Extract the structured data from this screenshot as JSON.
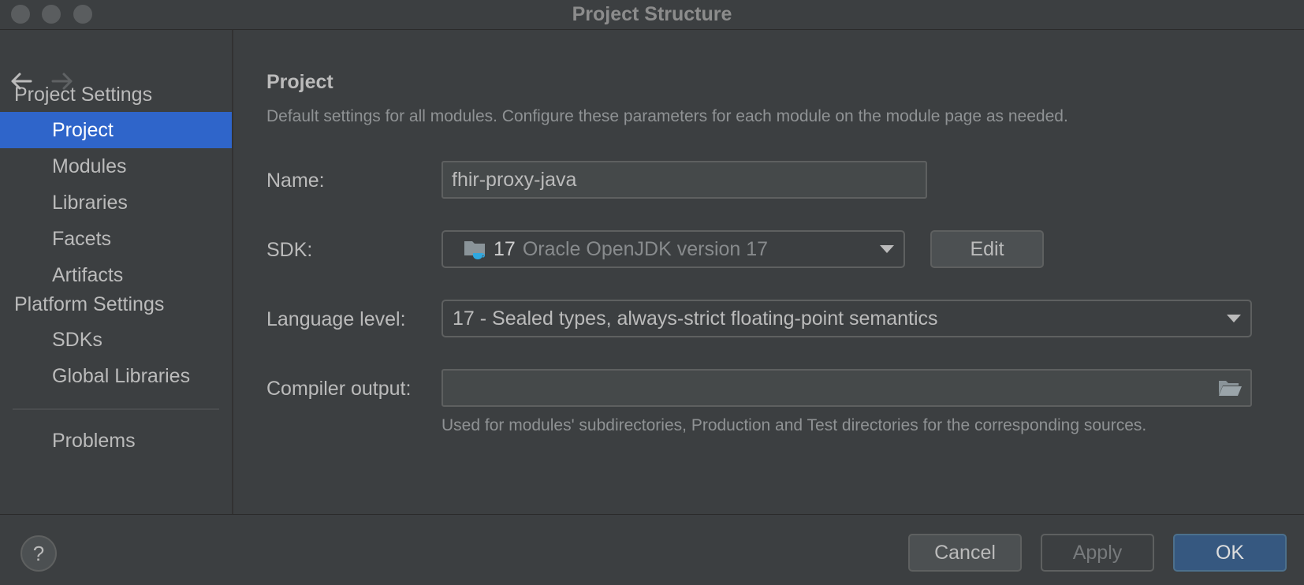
{
  "window": {
    "title": "Project Structure"
  },
  "sidebar": {
    "project_settings_label": "Project Settings",
    "platform_settings_label": "Platform Settings",
    "items": [
      {
        "label": "Project",
        "selected": true
      },
      {
        "label": "Modules"
      },
      {
        "label": "Libraries"
      },
      {
        "label": "Facets"
      },
      {
        "label": "Artifacts"
      },
      {
        "label": "SDKs"
      },
      {
        "label": "Global Libraries"
      },
      {
        "label": "Problems"
      }
    ]
  },
  "main": {
    "heading": "Project",
    "description": "Default settings for all modules. Configure these parameters for each module on the module page as needed.",
    "name_label": "Name:",
    "name_value": "fhir-proxy-java",
    "sdk_label": "SDK:",
    "sdk_version": "17",
    "sdk_name": "Oracle OpenJDK version 17",
    "edit_button": "Edit",
    "language_level_label": "Language level:",
    "language_level_value": "17 - Sealed types, always-strict floating-point semantics",
    "compiler_output_label": "Compiler output:",
    "compiler_output_value": "",
    "compiler_output_hint": "Used for modules' subdirectories, Production and Test directories for the corresponding sources."
  },
  "footer": {
    "help": "?",
    "cancel": "Cancel",
    "apply": "Apply",
    "ok": "OK"
  },
  "colors": {
    "background": "#3c3f41",
    "selection": "#2f65ca",
    "primary_button": "#365880",
    "sdk_icon": "#2fa8e0"
  }
}
